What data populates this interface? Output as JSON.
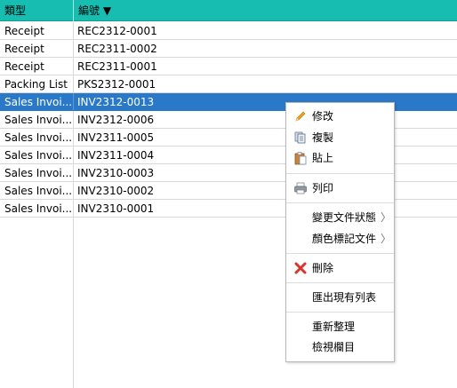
{
  "table": {
    "columns": {
      "type": "類型",
      "code": "編號 ▼"
    },
    "rows": [
      {
        "type": "Receipt",
        "code": "REC2312-0001"
      },
      {
        "type": "Receipt",
        "code": "REC2311-0002"
      },
      {
        "type": "Receipt",
        "code": "REC2311-0001"
      },
      {
        "type": "Packing List",
        "code": "PKS2312-0001"
      },
      {
        "type": "Sales Invoi...",
        "code": "INV2312-0013"
      },
      {
        "type": "Sales Invoi...",
        "code": "INV2312-0006"
      },
      {
        "type": "Sales Invoi...",
        "code": "INV2311-0005"
      },
      {
        "type": "Sales Invoi...",
        "code": "INV2311-0004"
      },
      {
        "type": "Sales Invoi...",
        "code": "INV2310-0003"
      },
      {
        "type": "Sales Invoi...",
        "code": "INV2310-0002"
      },
      {
        "type": "Sales Invoi...",
        "code": "INV2310-0001"
      }
    ],
    "selected_row_code": "INV2312-0013"
  },
  "context_menu": {
    "edit": "修改",
    "copy": "複製",
    "paste": "貼上",
    "print": "列印",
    "change_status": "變更文件狀態",
    "color_mark": "顏色標記文件",
    "delete": "刪除",
    "export_list": "匯出現有列表",
    "refresh": "重新整理",
    "view_columns": "檢視欄目",
    "submenu_arrow": "〉"
  },
  "colors": {
    "header_bg": "#17bdb0",
    "selected_row_bg": "#2a79c9",
    "delete_icon": "#d9342b"
  }
}
